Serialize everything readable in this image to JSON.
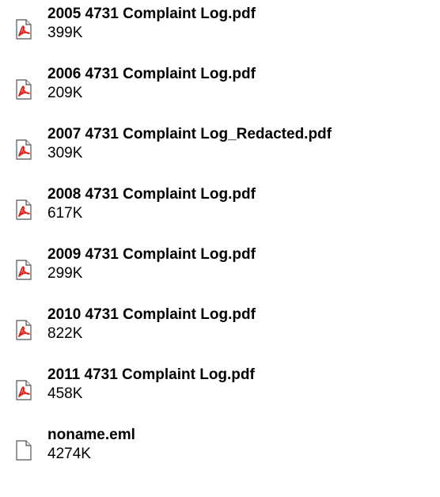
{
  "attachments": [
    {
      "name": "2005 4731 Complaint Log.pdf",
      "size": "399K",
      "icon": "pdf-icon"
    },
    {
      "name": "2006 4731 Complaint Log.pdf",
      "size": "209K",
      "icon": "pdf-icon"
    },
    {
      "name": "2007 4731 Complaint Log_Redacted.pdf",
      "size": "309K",
      "icon": "pdf-icon"
    },
    {
      "name": "2008 4731 Complaint Log.pdf",
      "size": "617K",
      "icon": "pdf-icon"
    },
    {
      "name": "2009 4731 Complaint Log.pdf",
      "size": "299K",
      "icon": "pdf-icon"
    },
    {
      "name": "2010 4731 Complaint Log.pdf",
      "size": "822K",
      "icon": "pdf-icon"
    },
    {
      "name": "2011 4731 Complaint Log.pdf",
      "size": "458K",
      "icon": "pdf-icon"
    },
    {
      "name": "noname.eml",
      "size": "4274K",
      "icon": "document-icon"
    }
  ],
  "colors": {
    "pdf_red": "#e0201b",
    "icon_border": "#555555"
  }
}
